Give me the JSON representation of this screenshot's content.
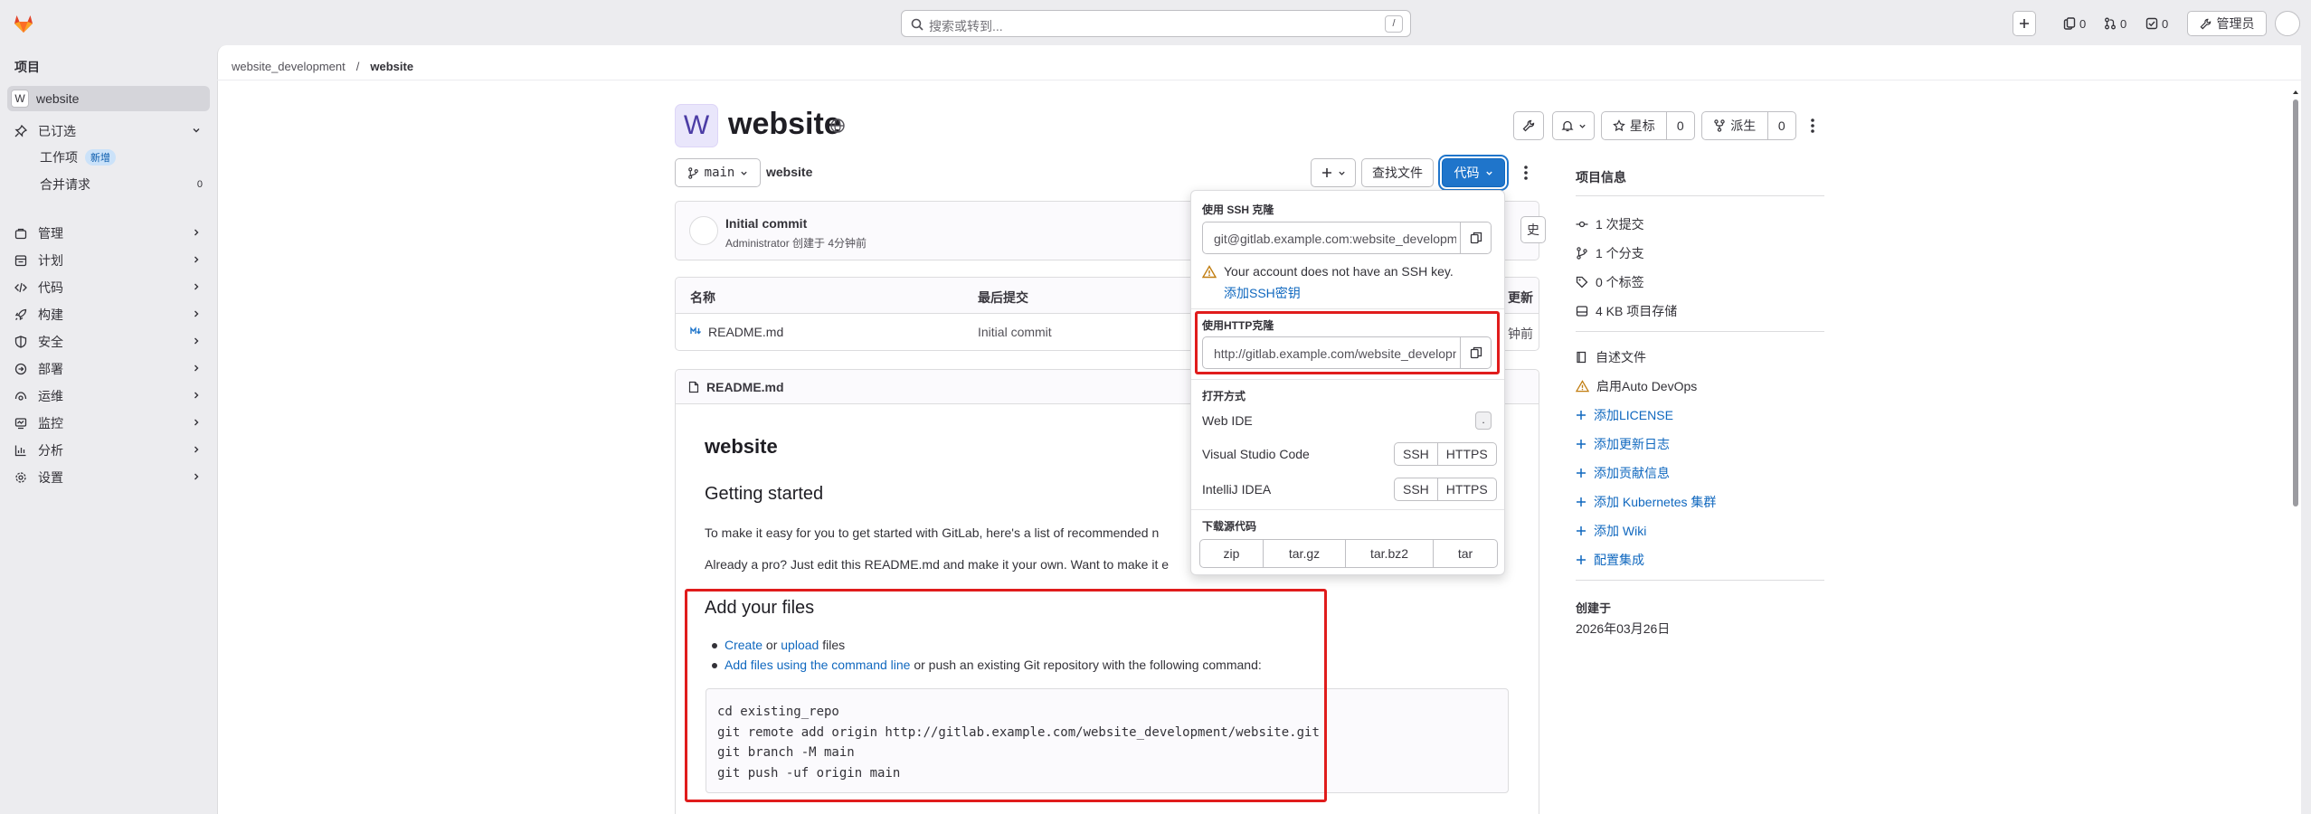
{
  "header": {
    "search_placeholder": "搜索或转到...",
    "search_shortcut": "/",
    "counts": {
      "issues": "0",
      "merge_requests": "0",
      "todos": "0"
    },
    "admin_label": "管理员"
  },
  "sidebar": {
    "section_title": "项目",
    "project": {
      "avatar_letter": "W",
      "name": "website"
    },
    "pinned": {
      "label": "已订选",
      "items": [
        {
          "label": "工作项",
          "badge": "新增"
        },
        {
          "label": "合并请求",
          "count": "0"
        }
      ]
    },
    "nav": [
      {
        "label": "管理",
        "icon": "manage-icon"
      },
      {
        "label": "计划",
        "icon": "plan-icon"
      },
      {
        "label": "代码",
        "icon": "code-icon"
      },
      {
        "label": "构建",
        "icon": "rocket-icon"
      },
      {
        "label": "安全",
        "icon": "shield-icon"
      },
      {
        "label": "部署",
        "icon": "deploy-icon"
      },
      {
        "label": "运维",
        "icon": "operate-icon"
      },
      {
        "label": "监控",
        "icon": "monitor-icon"
      },
      {
        "label": "分析",
        "icon": "chart-icon"
      },
      {
        "label": "设置",
        "icon": "gear-icon"
      }
    ]
  },
  "breadcrumb": {
    "group": "website_development",
    "separator": "/",
    "project": "website"
  },
  "project": {
    "avatar_letter": "W",
    "name": "website",
    "star_label": "星标",
    "star_count": "0",
    "fork_label": "派生",
    "fork_count": "0"
  },
  "repo_bar": {
    "branch": "main",
    "path": "website",
    "find_file": "查找文件",
    "code_button": "代码"
  },
  "commit": {
    "title": "Initial commit",
    "meta": "Administrator 创建于 4分钟前",
    "right_fragment": "史"
  },
  "file_table": {
    "headers": [
      "名称",
      "最后提交",
      "最后更新"
    ],
    "header_fragment_last_update": "更新",
    "rows": [
      {
        "name": "README.md",
        "commit": "Initial commit",
        "updated_fragment": "钟前"
      }
    ]
  },
  "readme": {
    "filename": "README.md",
    "h1": "website",
    "h2_getting_started": "Getting started",
    "para1": "To make it easy for you to get started with GitLab, here's a list of recommended n",
    "para2": "Already a pro? Just edit this README.md and make it your own. Want to make it e",
    "h2_add_files": "Add your files",
    "bullet1": {
      "link1": "Create",
      "text1": " or ",
      "link2": "upload",
      "text2": " files"
    },
    "bullet2": {
      "link": "Add files using the command line",
      "text": " or push an existing Git repository with the following command:"
    },
    "code_lines": [
      "cd existing_repo",
      "git remote add origin http://gitlab.example.com/website_development/website.git",
      "git branch -M main",
      "git push -uf origin main"
    ]
  },
  "code_dropdown": {
    "ssh_heading": "使用 SSH 克隆",
    "ssh_url": "git@gitlab.example.com:website_development/website.git",
    "ssh_warning": "Your account does not have an SSH key.",
    "ssh_add_key": "添加SSH密钥",
    "http_heading": "使用HTTP克隆",
    "http_url": "http://gitlab.example.com/website_development/website.git",
    "open_with_heading": "打开方式",
    "web_ide": "Web IDE",
    "web_ide_shortcut": ".",
    "vscode": "Visual Studio Code",
    "intellij": "IntelliJ IDEA",
    "ssh": "SSH",
    "https": "HTTPS",
    "download_heading": "下载源代码",
    "formats": [
      "zip",
      "tar.gz",
      "tar.bz2",
      "tar"
    ]
  },
  "project_info": {
    "heading": "项目信息",
    "stats": [
      "1 次提交",
      "1 个分支",
      "0 个标签",
      "4 KB 项目存储"
    ],
    "readme_link": "自述文件",
    "auto_devops": "启用Auto DevOps",
    "add_links": [
      "添加LICENSE",
      "添加更新日志",
      "添加贡献信息",
      "添加 Kubernetes 集群",
      "添加 Wiki",
      "配置集成"
    ],
    "created_label": "创建于",
    "created_date": "2026年03月26日"
  },
  "colors": {
    "accent": "#1f75cb",
    "highlight": "#e01c1c",
    "link": "#1068bf"
  }
}
